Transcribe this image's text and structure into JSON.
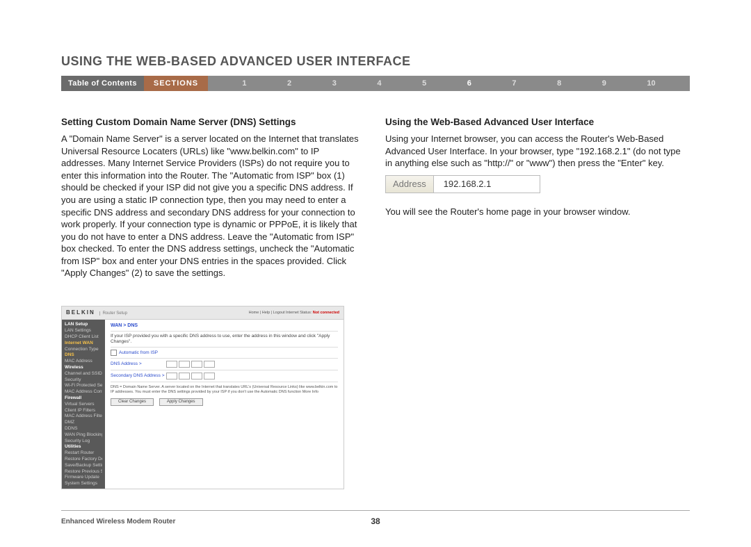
{
  "title": "USING THE WEB-BASED ADVANCED USER INTERFACE",
  "nav": {
    "toc": "Table of Contents",
    "sections_label": "SECTIONS",
    "numbers": [
      "1",
      "2",
      "3",
      "4",
      "5",
      "6",
      "7",
      "8",
      "9",
      "10"
    ],
    "active_index": 5
  },
  "left": {
    "heading": "Setting Custom Domain Name Server (DNS) Settings",
    "body": "A \"Domain Name Server\" is a server located on the Internet that translates Universal Resource Locaters (URLs) like \"www.belkin.com\" to IP addresses. Many Internet Service Providers (ISPs) do not require you to enter this information into the Router. The \"Automatic from ISP\" box (1) should be checked if your ISP did not give you a specific DNS address. If you are using a static IP connection type, then you may need to enter a specific DNS address and secondary DNS address for your connection to work properly. If your connection type is dynamic or PPPoE, it is likely that you do not have to enter a DNS address. Leave the \"Automatic from ISP\" box checked. To enter the DNS address settings, uncheck the \"Automatic from ISP\" box and enter your DNS entries in the spaces provided. Click \"Apply Changes\" (2) to save the settings."
  },
  "right": {
    "heading": "Using the Web-Based Advanced User Interface",
    "body1": "Using your Internet browser, you can access the Router's Web-Based Advanced User Interface. In your browser, type \"192.168.2.1\" (do not type in anything else such as \"http://\" or \"www\") then press the \"Enter\" key.",
    "addr_label": "Address",
    "addr_value": "192.168.2.1",
    "body2": "You will see the Router's home page in your browser window."
  },
  "router": {
    "logo": "BELKIN",
    "logo_sub": "Router Setup",
    "toplinks": "Home | Help | Logout   Internet Status:",
    "status": "Not connected",
    "sidebar": [
      {
        "t": "LAN Setup",
        "c": "cat"
      },
      {
        "t": "LAN Settings"
      },
      {
        "t": "DHCP Client List"
      },
      {
        "t": "Internet WAN",
        "c": "hl"
      },
      {
        "t": "Connection Type"
      },
      {
        "t": "DNS",
        "c": "hl"
      },
      {
        "t": "MAC Address"
      },
      {
        "t": "Wireless",
        "c": "cat"
      },
      {
        "t": "Channel and SSID"
      },
      {
        "t": "Security"
      },
      {
        "t": "Wi-Fi Protected Setup"
      },
      {
        "t": "MAC Address Control"
      },
      {
        "t": "Firewall",
        "c": "cat"
      },
      {
        "t": "Virtual Servers"
      },
      {
        "t": "Client IP Filters"
      },
      {
        "t": "MAC Address Filtering"
      },
      {
        "t": "DMZ"
      },
      {
        "t": "DDNS"
      },
      {
        "t": "WAN Ping Blocking"
      },
      {
        "t": "Security Log"
      },
      {
        "t": "Utilities",
        "c": "cat"
      },
      {
        "t": "Restart Router"
      },
      {
        "t": "Restore Factory Defaults"
      },
      {
        "t": "Save/Backup Settings"
      },
      {
        "t": "Restore Previous Settings"
      },
      {
        "t": "Firmware Update"
      },
      {
        "t": "System Settings"
      }
    ],
    "crumb": "WAN > DNS",
    "intro": "If your ISP provided you with a specific DNS address to use, enter the address in this window and click \"Apply Changes\".",
    "auto_label": "Automatic from ISP",
    "dns_label": "DNS Address >",
    "dns2_label": "Secondary DNS Address >",
    "desc": "DNS = Domain Name Server. A server located on the Internet that translates URL's (Universal Resource Links) like www.belkin.com to IP addresses. You must enter the DNS settings provided by your ISP if you don't use the Automatic DNS function More Info",
    "btn_clear": "Clear Changes",
    "btn_apply": "Apply Changes"
  },
  "footer": {
    "product": "Enhanced Wireless Modem Router",
    "page_number": "38"
  }
}
